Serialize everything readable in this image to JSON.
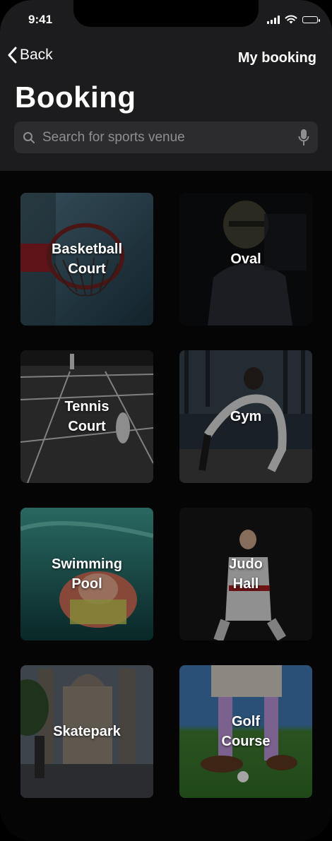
{
  "status_bar": {
    "time": "9:41"
  },
  "nav": {
    "back_label": "Back",
    "my_booking_label": "My booking"
  },
  "page": {
    "title": "Booking"
  },
  "search": {
    "placeholder": "Search for sports venue",
    "value": ""
  },
  "venues": [
    {
      "label": "Basketball\nCourt",
      "icon": "basketball-hoop-photo"
    },
    {
      "label": "Oval",
      "icon": "football-player-photo"
    },
    {
      "label": "Tennis\nCourt",
      "icon": "tennis-court-photo"
    },
    {
      "label": "Gym",
      "icon": "gym-workout-photo"
    },
    {
      "label": "Swimming\nPool",
      "icon": "swimmer-underwater-photo"
    },
    {
      "label": "Judo\nHall",
      "icon": "judo-athlete-photo"
    },
    {
      "label": "Skatepark",
      "icon": "skateboarder-church-photo"
    },
    {
      "label": "Golf\nCourse",
      "icon": "golfer-putting-photo"
    }
  ],
  "colors": {
    "header_bg": "#1c1c1e",
    "page_bg": "#050505",
    "search_bg": "#2c2c2e",
    "placeholder": "#8e8e93"
  }
}
